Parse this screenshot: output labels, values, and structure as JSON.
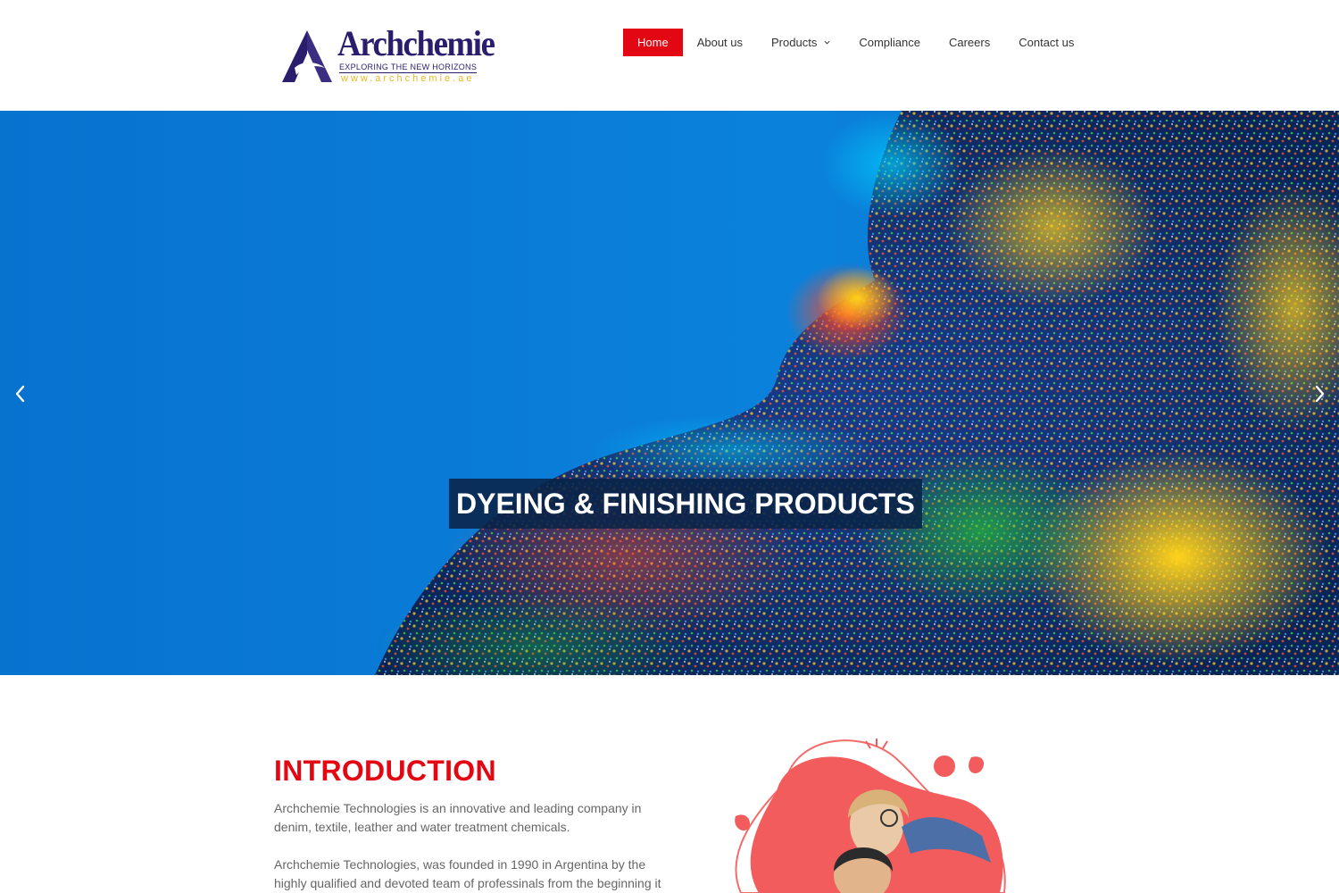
{
  "brand": {
    "name": "Archchemie",
    "tagline": "EXPLORING THE NEW HORIZONS",
    "url": "www.archchemie.ae",
    "colors": {
      "primary": "#2b1d6e",
      "accent": "#e8b822",
      "red": "#e30613"
    }
  },
  "nav": {
    "items": [
      {
        "label": "Home",
        "active": true
      },
      {
        "label": "About us"
      },
      {
        "label": "Products",
        "has_dropdown": true
      },
      {
        "label": "Compliance"
      },
      {
        "label": "Careers"
      },
      {
        "label": "Contact us"
      }
    ]
  },
  "hero": {
    "caption": "DYEING & FINISHING PRODUCTS",
    "prev_icon": "chevron-left-icon",
    "next_icon": "chevron-right-icon"
  },
  "intro": {
    "title": "INTRODUCTION",
    "paragraph1": "Archchemie Technologies is an innovative and leading company in denim, textile, leather and water treatment chemicals.",
    "paragraph2": "Archchemie Technologies, was founded in 1990 in Argentina by the highly qualified and devoted team of professinals from the beginning it"
  }
}
